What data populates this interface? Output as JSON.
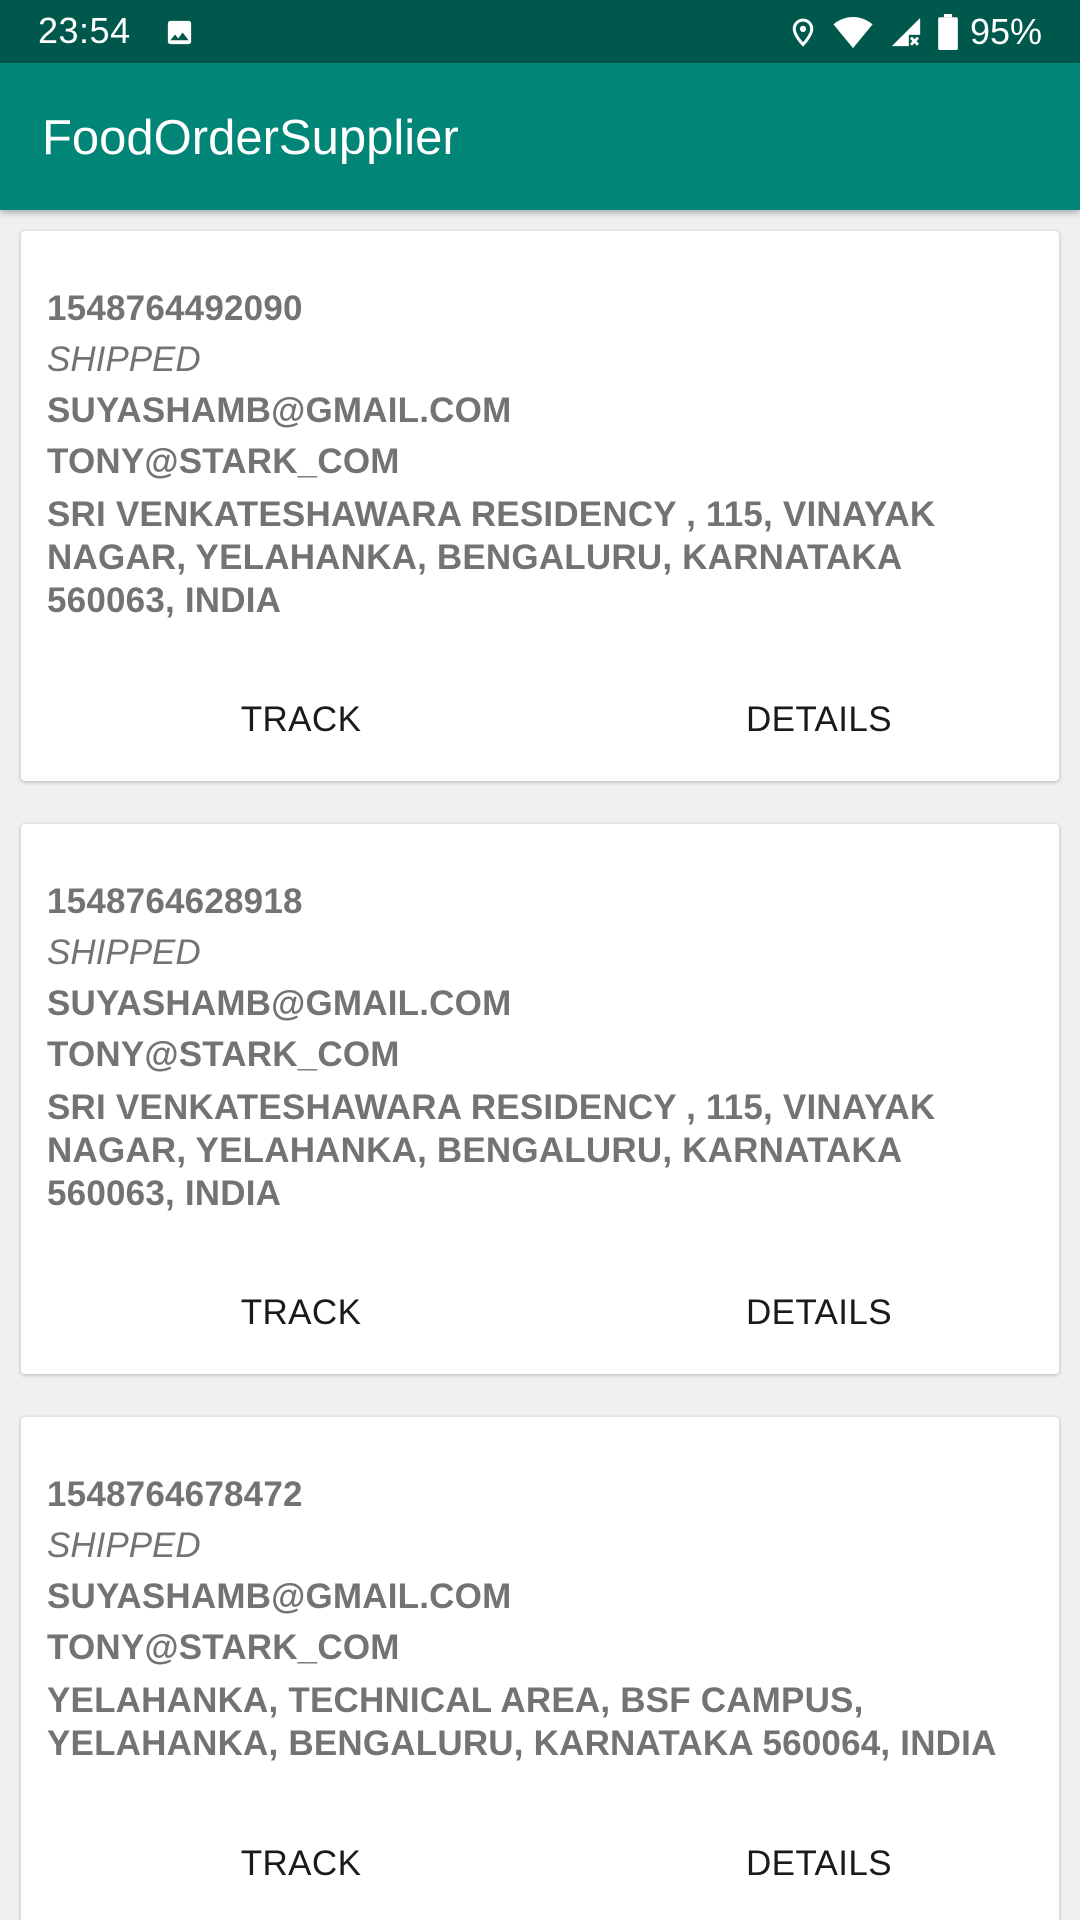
{
  "status_bar": {
    "time": "23:54",
    "battery": "95%",
    "icons": [
      "image-icon",
      "location-icon",
      "wifi-icon",
      "signal-icon",
      "battery-icon"
    ]
  },
  "app_bar": {
    "title": "FoodOrderSupplier"
  },
  "colors": {
    "primary": "#008577",
    "primary_dark": "#00574b",
    "text_secondary": "#737373"
  },
  "orders": [
    {
      "id": "1548764492090",
      "status": "SHIPPED",
      "customer_email": "SUYASHAMB@GMAIL.COM",
      "supplier_email": "TONY@STARK_COM",
      "address": "SRI VENKATESHAWARA RESIDENCY , 115, VINAYAK NAGAR, YELAHANKA, BENGALURU, KARNATAKA 560063, INDIA",
      "track_label": "TRACK",
      "details_label": "DETAILS"
    },
    {
      "id": "1548764628918",
      "status": "SHIPPED",
      "customer_email": "SUYASHAMB@GMAIL.COM",
      "supplier_email": "TONY@STARK_COM",
      "address": "SRI VENKATESHAWARA RESIDENCY , 115, VINAYAK NAGAR, YELAHANKA, BENGALURU, KARNATAKA 560063, INDIA",
      "track_label": "TRACK",
      "details_label": "DETAILS"
    },
    {
      "id": "1548764678472",
      "status": "SHIPPED",
      "customer_email": "SUYASHAMB@GMAIL.COM",
      "supplier_email": "TONY@STARK_COM",
      "address": "YELAHANKA, TECHNICAL AREA, BSF CAMPUS, YELAHANKA, BENGALURU, KARNATAKA 560064, INDIA",
      "track_label": "TRACK",
      "details_label": "DETAILS"
    }
  ]
}
